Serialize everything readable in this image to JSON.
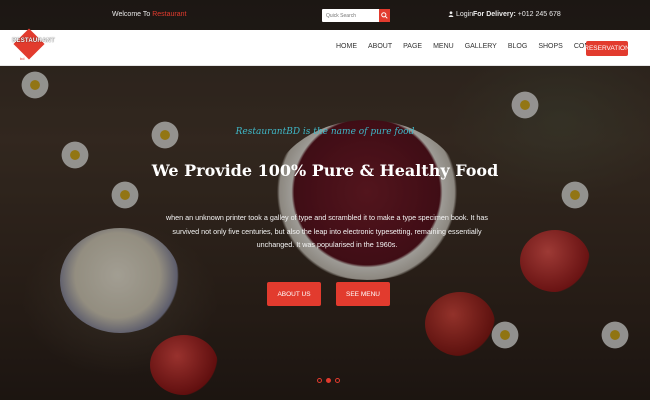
{
  "topbar": {
    "welcome_prefix": "Welcome To",
    "welcome_accent": "Restaurant",
    "search_placeholder": "Quick Search",
    "login_label": "Login",
    "delivery_label": "For Delivery:",
    "delivery_phone": "+012 245 678"
  },
  "logo": {
    "name": "RESTAURANT",
    "sub": "bd"
  },
  "nav": {
    "items": [
      "HOME",
      "ABOUT",
      "PAGE",
      "MENU",
      "GALLERY",
      "BLOG",
      "SHOPS",
      "CONTACT"
    ],
    "reservation": "RESERVATION"
  },
  "hero": {
    "tagline": "RestaurantBD is the name of pure food",
    "headline": "We Provide 100% Pure & Healthy Food",
    "description": "when an unknown printer took a galley of type and scrambled it to make a type specimen book. It has survived not only five centuries, but also the leap into electronic typesetting, remaining essentially unchanged. It was popularised in the 1960s.",
    "about_button": "ABOUT US",
    "menu_button": "SEE MENU",
    "active_slide": 1,
    "slide_count": 3
  },
  "colors": {
    "accent": "#e23b2e",
    "tagline": "#3fb8c8"
  }
}
